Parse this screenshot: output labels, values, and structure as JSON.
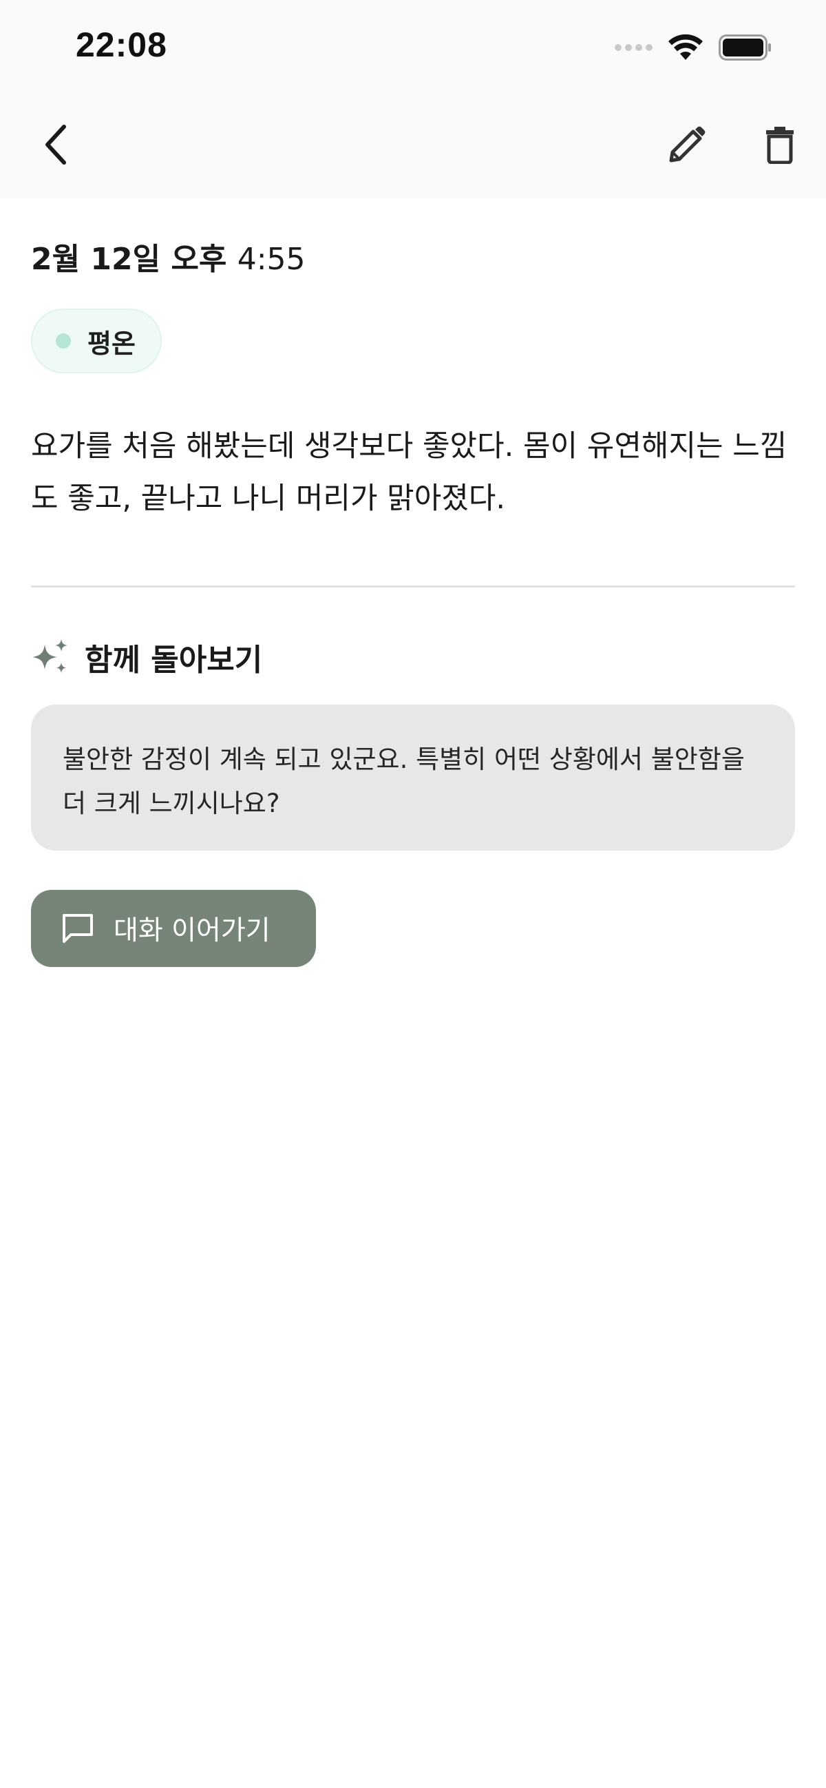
{
  "status_bar": {
    "time": "22:08"
  },
  "nav": {
    "back_icon": "chevron-left-icon",
    "edit_icon": "pencil-icon",
    "delete_icon": "trash-icon"
  },
  "entry": {
    "date": "2월 12일 오후",
    "time": "4:55",
    "mood": {
      "label": "평온",
      "color": "#b5e6d5"
    },
    "text": "요가를 처음 해봤는데 생각보다 좋았다. 몸이 유연해지는 느낌도 좋고, 끝나고 나니 머리가 맑아졌다."
  },
  "review": {
    "title": "함께 돌아보기",
    "icon": "sparkles-icon",
    "message": "불안한 감정이 계속 되고 있군요. 특별히 어떤 상황에서 불안함을 더 크게 느끼시나요?"
  },
  "continue_button": {
    "label": "대화 이어가기",
    "icon": "chat-bubble-icon",
    "color": "#768578"
  }
}
